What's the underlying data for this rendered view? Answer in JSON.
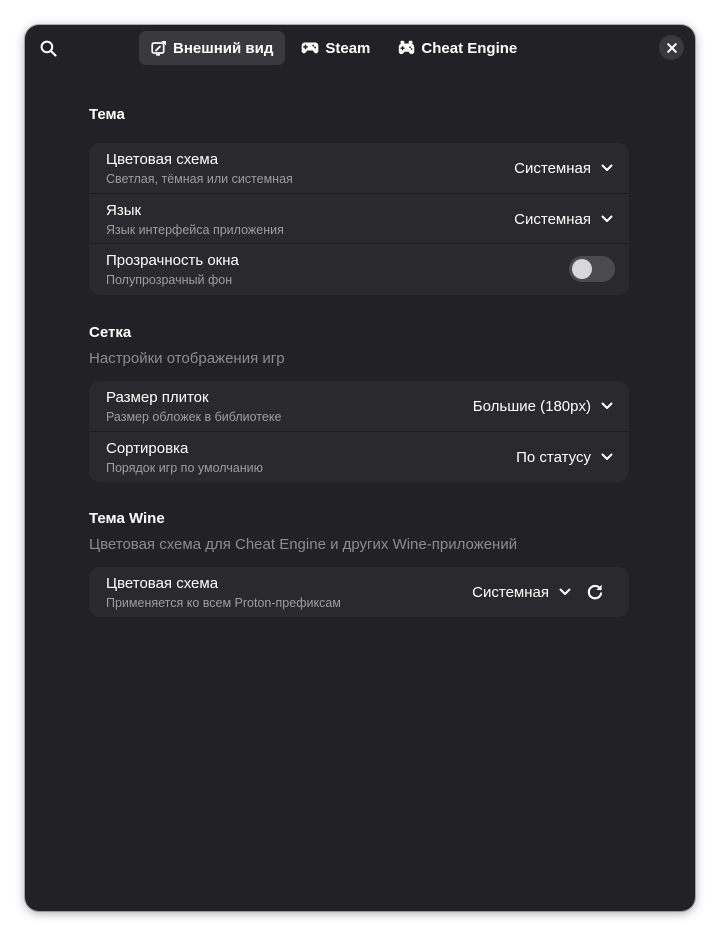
{
  "header": {
    "search_icon": "search-icon",
    "close_icon": "close-icon",
    "tabs": [
      {
        "label": "Внешний вид",
        "icon": "appearance-icon",
        "active": true
      },
      {
        "label": "Steam",
        "icon": "gamepad-icon",
        "active": false
      },
      {
        "label": "Cheat Engine",
        "icon": "gamepad-alt-icon",
        "active": false
      }
    ]
  },
  "theme_group": {
    "title": "Тема",
    "rows": [
      {
        "title": "Цветовая схема",
        "subtitle": "Светлая, тёмная или системная",
        "value": "Системная"
      },
      {
        "title": "Язык",
        "subtitle": "Язык интерфейса приложения",
        "value": "Системная"
      },
      {
        "title": "Прозрачность окна",
        "subtitle": "Полупрозрачный фон",
        "toggle_on": false
      }
    ]
  },
  "grid_group": {
    "title": "Сетка",
    "description": "Настройки отображения игр",
    "rows": [
      {
        "title": "Размер плиток",
        "subtitle": "Размер обложек в библиотеке",
        "value": "Большие (180px)"
      },
      {
        "title": "Сортировка",
        "subtitle": "Порядок игр по умолчанию",
        "value": "По статусу"
      }
    ]
  },
  "wine_group": {
    "title": "Тема Wine",
    "description": "Цветовая схема для Cheat Engine и других Wine-приложений",
    "rows": [
      {
        "title": "Цветовая схема",
        "subtitle": "Применяется ко всем Proton-префиксам",
        "value": "Системная"
      }
    ]
  },
  "colors": {
    "window_bg": "#222226",
    "row_bg": "#2a2a2e",
    "active_tab_bg": "#3a3a3e",
    "dim_text": "#8b8b90"
  }
}
